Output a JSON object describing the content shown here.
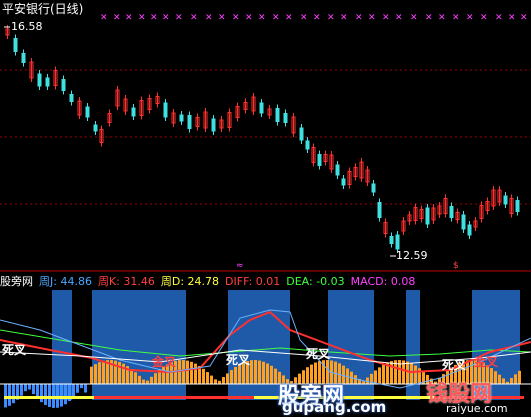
{
  "header": {
    "title": "平安银行(日线)",
    "price_high": "16.58",
    "price_low": "12.59"
  },
  "indicator": {
    "name": "股旁网",
    "items": [
      {
        "label": "周J: 44.86",
        "color": "#4aa8ff"
      },
      {
        "label": "周K: 31.46",
        "color": "#ff4040"
      },
      {
        "label": "周D: 24.78",
        "color": "#ffff40"
      },
      {
        "label": "DIFF: 0.01",
        "color": "#ff4040"
      },
      {
        "label": "DEA: -0.03",
        "color": "#40ff40"
      },
      {
        "label": "MACD: 0.08",
        "color": "#ff40ff"
      }
    ]
  },
  "signals": {
    "death_cross": "死叉",
    "golden_cross": "金叉"
  },
  "watermark": {
    "main": "股旁网",
    "url": "gupang.com",
    "logo": "钱股网",
    "url2": "raiyue.com"
  },
  "colors": {
    "up_candle": "#ff3030",
    "down_candle": "#40e0e0",
    "blue_block": "#1e5aa8",
    "orange_hist": "#ffa020",
    "dashed_grid": "#b00000"
  }
}
